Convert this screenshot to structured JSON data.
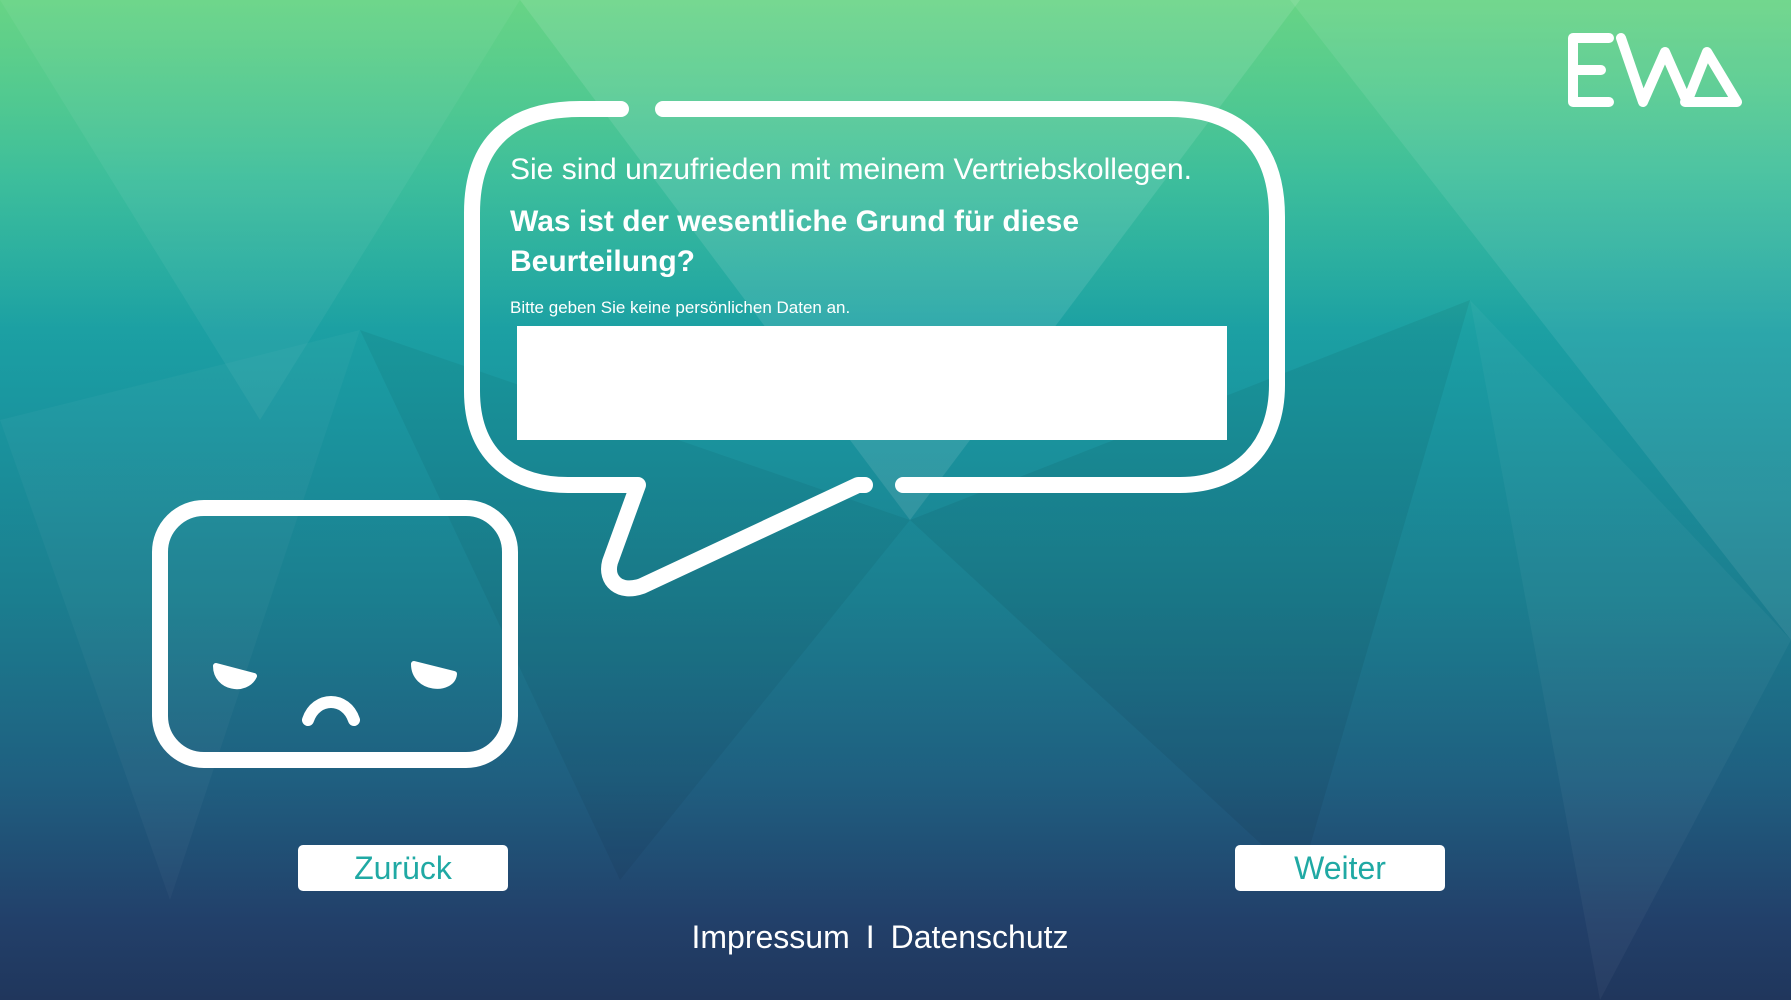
{
  "brand": {
    "logo_text": "EWA",
    "logo_color": "#ffffff"
  },
  "question": {
    "intro": "Sie sind unzufrieden mit meinem Vertriebskollegen.",
    "main": "Was ist der wesentliche Grund für diese Beurteilung?",
    "hint": "Bitte geben Sie keine persönlichen Daten an."
  },
  "answer": {
    "value": "",
    "placeholder": ""
  },
  "navigation": {
    "back_label": "Zurück",
    "next_label": "Weiter"
  },
  "footer": {
    "imprint_label": "Impressum",
    "separator": "I",
    "privacy_label": "Datenschutz"
  },
  "colors": {
    "accent": "#20a9a4",
    "text_on_bg": "#ffffff",
    "top": "#2fc7a0",
    "bottom": "#20365c"
  },
  "mascot": {
    "icon": "sad-face-icon",
    "speech_icon": "speech-bubble-icon"
  }
}
